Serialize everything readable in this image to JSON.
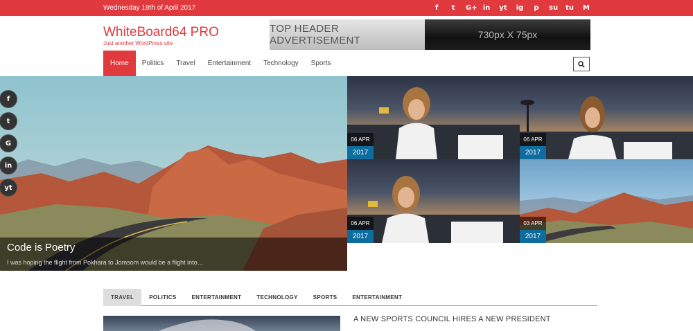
{
  "topbar": {
    "date": "Wednesday 19th of April 2017",
    "social": [
      "f",
      "t",
      "G+",
      "in",
      "yt",
      "ig",
      "p",
      "su",
      "tu",
      "M"
    ]
  },
  "header": {
    "site_title": "WhiteBoard64 PRO",
    "tagline": "Just another WordPress site",
    "ad_left": "TOP HEADER ADVERTISEMENT",
    "ad_right": "730px X 75px"
  },
  "nav": {
    "items": [
      {
        "label": "Home"
      },
      {
        "label": "Politics"
      },
      {
        "label": "Travel"
      },
      {
        "label": "Entertainment"
      },
      {
        "label": "Technology"
      },
      {
        "label": "Sports"
      }
    ]
  },
  "hero": {
    "main": {
      "title": "Code is Poetry",
      "excerpt": "I was hoping the flight from Pokhara to Jomsom would be a flight into…"
    },
    "tiles": [
      {
        "day": "06 APR",
        "year": "2017"
      },
      {
        "day": "06 APR",
        "year": "2017"
      },
      {
        "day": "06 APR",
        "year": "2017"
      },
      {
        "day": "03 APR",
        "year": "2017"
      }
    ]
  },
  "side_social": [
    "f",
    "t",
    "G",
    "in",
    "yt"
  ],
  "tabs": [
    "TRAVEL",
    "POLITICS",
    "ENTERTAINMENT",
    "TECHNOLOGY",
    "SPORTS",
    "ENTERTAINMENT"
  ],
  "bottom": {
    "headline": "A NEW SPORTS COUNCIL HIRES A NEW PRESIDENT"
  },
  "colors": {
    "accent": "#e0393e",
    "date_badge": "#0e6c9e"
  }
}
